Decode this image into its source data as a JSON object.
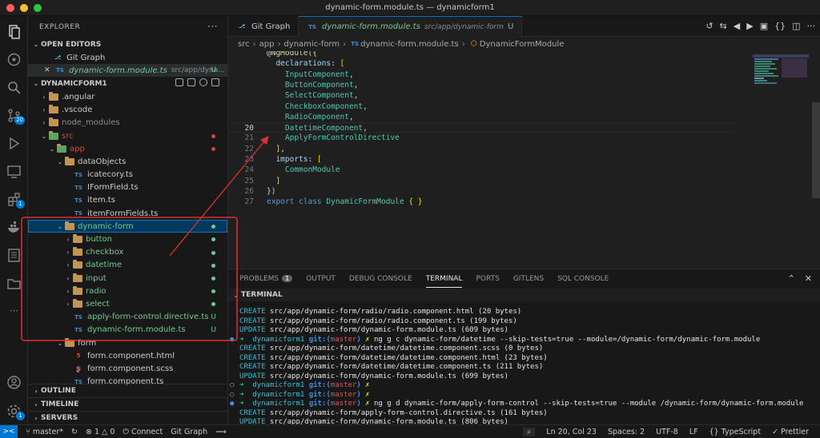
{
  "window": {
    "title": "dynamic-form.module.ts — dynamicform1"
  },
  "activity_bar": {
    "items": [
      {
        "name": "explorer-icon"
      },
      {
        "name": "git-graph-icon"
      },
      {
        "name": "search-icon"
      },
      {
        "name": "source-control-icon",
        "badge": "20"
      },
      {
        "name": "run-debug-icon"
      },
      {
        "name": "remote-explorer-icon"
      },
      {
        "name": "extensions-icon",
        "badge": "1"
      },
      {
        "name": "docker-icon"
      },
      {
        "name": "notebook-icon"
      },
      {
        "name": "folder-icon"
      },
      {
        "name": "more-icon",
        "glyph": "···"
      }
    ],
    "bottom": [
      {
        "name": "account-icon"
      },
      {
        "name": "manage-gear-icon",
        "badge": "1"
      }
    ]
  },
  "sidebar": {
    "title": "EXPLORER",
    "open_editors": {
      "label": "OPEN EDITORS",
      "items": [
        {
          "icon": "git-graph-icon",
          "label": "Git Graph",
          "desc": "",
          "deco": ""
        },
        {
          "icon": "TS",
          "label": "dynamic-form.module.ts",
          "desc": "src/app/dyna...",
          "deco": "U",
          "close": "✕"
        }
      ]
    },
    "project": {
      "label": "DYNAMICFORM1",
      "tree": [
        {
          "depth": 1,
          "chev": "›",
          "type": "folder",
          "label": ".angular",
          "color": "#cccccc"
        },
        {
          "depth": 1,
          "chev": "›",
          "type": "folder",
          "label": ".vscode",
          "color": "#cccccc"
        },
        {
          "depth": 1,
          "chev": "›",
          "type": "folder",
          "label": "node_modules",
          "color": "#8c8c8c"
        },
        {
          "depth": 1,
          "chev": "⌄",
          "type": "folder",
          "label": "src",
          "color": "#c74e39",
          "dot": "#c74e39"
        },
        {
          "depth": 2,
          "chev": "⌄",
          "type": "folder",
          "label": "app",
          "color": "#c74e39",
          "dot": "#c74e39"
        },
        {
          "depth": 3,
          "chev": "⌄",
          "type": "folder",
          "label": "dataObjects",
          "color": "#cccccc"
        },
        {
          "depth": 4,
          "chev": "",
          "type": "TS",
          "label": "icatecory.ts",
          "color": "#cccccc"
        },
        {
          "depth": 4,
          "chev": "",
          "type": "TS",
          "label": "IFormField.ts",
          "color": "#cccccc"
        },
        {
          "depth": 4,
          "chev": "",
          "type": "TS",
          "label": "item.ts",
          "color": "#cccccc"
        },
        {
          "depth": 4,
          "chev": "",
          "type": "TS",
          "label": "itemFormFields.ts",
          "color": "#cccccc"
        },
        {
          "depth": 3,
          "chev": "⌄",
          "type": "folder",
          "label": "dynamic-form",
          "color": "#73c991",
          "dot": "#73c991",
          "selected": true
        },
        {
          "depth": 4,
          "chev": "›",
          "type": "folder",
          "label": "button",
          "color": "#73c991",
          "dot": "#73c991"
        },
        {
          "depth": 4,
          "chev": "›",
          "type": "folder",
          "label": "checkbox",
          "color": "#73c991",
          "dot": "#73c991"
        },
        {
          "depth": 4,
          "chev": "›",
          "type": "folder",
          "label": "datetime",
          "color": "#73c991",
          "dot": "#73c991"
        },
        {
          "depth": 4,
          "chev": "›",
          "type": "folder",
          "label": "input",
          "color": "#73c991",
          "dot": "#73c991"
        },
        {
          "depth": 4,
          "chev": "›",
          "type": "folder",
          "label": "radio",
          "color": "#73c991",
          "dot": "#73c991"
        },
        {
          "depth": 4,
          "chev": "›",
          "type": "folder",
          "label": "select",
          "color": "#73c991",
          "dot": "#73c991"
        },
        {
          "depth": 4,
          "chev": "",
          "type": "TS",
          "label": "apply-form-control.directive.ts",
          "color": "#73c991",
          "deco": "U"
        },
        {
          "depth": 4,
          "chev": "",
          "type": "TS",
          "label": "dynamic-form.module.ts",
          "color": "#73c991",
          "deco": "U"
        },
        {
          "depth": 3,
          "chev": "⌄",
          "type": "folder",
          "label": "form",
          "color": "#cccccc"
        },
        {
          "depth": 4,
          "chev": "",
          "type": "html",
          "label": "form.component.html",
          "color": "#cccccc"
        },
        {
          "depth": 4,
          "chev": "",
          "type": "scss",
          "label": "form.component.scss",
          "color": "#cccccc"
        },
        {
          "depth": 4,
          "chev": "",
          "type": "TS",
          "label": "form.component.ts",
          "color": "#cccccc"
        }
      ]
    },
    "bottom_sections": [
      "OUTLINE",
      "TIMELINE",
      "SERVERS"
    ]
  },
  "tabs": [
    {
      "label": "Git Graph",
      "desc": "",
      "deco": ""
    },
    {
      "label": "dynamic-form.module.ts",
      "desc": "src/app/dynamic-form",
      "deco": "U",
      "active": true
    }
  ],
  "breadcrumb": [
    "src",
    "app",
    "dynamic-form",
    "dynamic-form.module.ts",
    "DynamicFormModule"
  ],
  "code_lines": [
    {
      "n": "",
      "t": [
        [
          "@NgModule({",
          "dec"
        ]
      ]
    },
    {
      "n": "",
      "t": [
        [
          "  declarations",
          "pr"
        ],
        [
          ": ",
          "pu"
        ],
        [
          "[",
          "br"
        ]
      ]
    },
    {
      "n": "",
      "t": [
        [
          "    InputComponent",
          "ty"
        ],
        [
          ",",
          "pu"
        ]
      ]
    },
    {
      "n": "",
      "t": [
        [
          "    ButtonComponent",
          "ty"
        ],
        [
          ",",
          "pu"
        ]
      ]
    },
    {
      "n": "",
      "t": [
        [
          "    SelectComponent",
          "ty"
        ],
        [
          ",",
          "pu"
        ]
      ]
    },
    {
      "n": "",
      "t": [
        [
          "    CheckboxComponent",
          "ty"
        ],
        [
          ",",
          "pu"
        ]
      ]
    },
    {
      "n": "",
      "t": [
        [
          "    RadioComponent",
          "ty"
        ],
        [
          ",",
          "pu"
        ]
      ]
    },
    {
      "n": "20",
      "t": [
        [
          "    DatetimeComponent",
          "ty"
        ],
        [
          ",",
          "pu"
        ]
      ],
      "current": true
    },
    {
      "n": "21",
      "t": [
        [
          "    ApplyFormControlDirective",
          "ty"
        ]
      ]
    },
    {
      "n": "22",
      "t": [
        [
          "  ",
          "pu"
        ],
        [
          "]",
          "br"
        ],
        [
          ",",
          "pu"
        ]
      ]
    },
    {
      "n": "23",
      "t": [
        [
          "  imports",
          "pr"
        ],
        [
          ": ",
          "pu"
        ],
        [
          "[",
          "br"
        ]
      ]
    },
    {
      "n": "24",
      "t": [
        [
          "    CommonModule",
          "ty"
        ]
      ]
    },
    {
      "n": "25",
      "t": [
        [
          "  ",
          "pu"
        ],
        [
          "]",
          "br"
        ]
      ]
    },
    {
      "n": "26",
      "t": [
        [
          "})",
          "pu"
        ]
      ]
    },
    {
      "n": "27",
      "t": [
        [
          "export ",
          "kw"
        ],
        [
          "class ",
          "kw"
        ],
        [
          "DynamicFormModule ",
          "ty"
        ],
        [
          "{ }",
          "br"
        ]
      ]
    }
  ],
  "panel": {
    "tabs": [
      {
        "label": "PROBLEMS",
        "badge": "1"
      },
      {
        "label": "OUTPUT"
      },
      {
        "label": "DEBUG CONSOLE"
      },
      {
        "label": "TERMINAL",
        "active": true
      },
      {
        "label": "PORTS"
      },
      {
        "label": "GITLENS"
      },
      {
        "label": "SQL CONSOLE"
      }
    ],
    "terminal_header": "TERMINAL",
    "lines": [
      {
        "m": "",
        "s": [
          [
            "CREATE",
            "cy"
          ],
          [
            " src/app/dynamic-form/radio/radio.component.html (20 bytes)",
            "wh"
          ]
        ]
      },
      {
        "m": "",
        "s": [
          [
            "CREATE",
            "cy"
          ],
          [
            " src/app/dynamic-form/radio/radio.component.ts (199 bytes)",
            "wh"
          ]
        ]
      },
      {
        "m": "",
        "s": [
          [
            "UPDATE",
            "cy"
          ],
          [
            " src/app/dynamic-form/dynamic-form.module.ts (609 bytes)",
            "wh"
          ]
        ]
      },
      {
        "m": "●",
        "mc": "#3b8eea",
        "s": [
          [
            "➜  ",
            "arr"
          ],
          [
            "dynamicform1 ",
            "cy"
          ],
          [
            "git:(",
            "gl"
          ],
          [
            "master",
            "rd"
          ],
          [
            ") ",
            "gl"
          ],
          [
            "✗ ",
            "yl"
          ],
          [
            "ng g c dynamic-form/datetime --skip-tests=true --module=/dynamic-form/dynamic-form.module",
            "wh"
          ]
        ]
      },
      {
        "m": "",
        "s": [
          [
            "CREATE",
            "cy"
          ],
          [
            " src/app/dynamic-form/datetime/datetime.component.scss (0 bytes)",
            "wh"
          ]
        ]
      },
      {
        "m": "",
        "s": [
          [
            "CREATE",
            "cy"
          ],
          [
            " src/app/dynamic-form/datetime/datetime.component.html (23 bytes)",
            "wh"
          ]
        ]
      },
      {
        "m": "",
        "s": [
          [
            "CREATE",
            "cy"
          ],
          [
            " src/app/dynamic-form/datetime/datetime.component.ts (211 bytes)",
            "wh"
          ]
        ]
      },
      {
        "m": "",
        "s": [
          [
            "UPDATE",
            "cy"
          ],
          [
            " src/app/dynamic-form/dynamic-form.module.ts (699 bytes)",
            "wh"
          ]
        ]
      },
      {
        "m": "○",
        "mc": "#999",
        "s": [
          [
            "➜  ",
            "arr"
          ],
          [
            "dynamicform1 ",
            "cy"
          ],
          [
            "git:(",
            "gl"
          ],
          [
            "master",
            "rd"
          ],
          [
            ") ",
            "gl"
          ],
          [
            "✗",
            "yl"
          ]
        ]
      },
      {
        "m": "○",
        "mc": "#999",
        "s": [
          [
            "➜  ",
            "arr"
          ],
          [
            "dynamicform1 ",
            "cy"
          ],
          [
            "git:(",
            "gl"
          ],
          [
            "master",
            "rd"
          ],
          [
            ") ",
            "gl"
          ],
          [
            "✗",
            "yl"
          ]
        ]
      },
      {
        "m": "●",
        "mc": "#3b8eea",
        "s": [
          [
            "➜  ",
            "arr"
          ],
          [
            "dynamicform1 ",
            "cy"
          ],
          [
            "git:(",
            "gl"
          ],
          [
            "master",
            "rd"
          ],
          [
            ") ",
            "gl"
          ],
          [
            "✗ ",
            "yl"
          ],
          [
            "ng g d dynamic-form/apply-form-control --skip-tests=true --module /dynamic-form/dynamic-form.module",
            "wh"
          ]
        ]
      },
      {
        "m": "",
        "s": [
          [
            "CREATE",
            "cy"
          ],
          [
            " src/app/dynamic-form/apply-form-control.directive.ts (161 bytes)",
            "wh"
          ]
        ]
      },
      {
        "m": "",
        "s": [
          [
            "UPDATE",
            "cy"
          ],
          [
            " src/app/dynamic-form/dynamic-form.module.ts (806 bytes)",
            "wh"
          ]
        ]
      },
      {
        "m": "○",
        "mc": "#999",
        "s": [
          [
            "➜  ",
            "arr"
          ],
          [
            "dynamicform1 ",
            "cy"
          ],
          [
            "git:(",
            "gl"
          ],
          [
            "master",
            "rd"
          ],
          [
            ") ",
            "gl"
          ],
          [
            "✗ ",
            "yl"
          ],
          [
            "▯",
            "wh"
          ]
        ]
      }
    ]
  },
  "statusbar": {
    "remote": "><",
    "branch": "master*",
    "sync": "↻",
    "problems": "⊗ 1 △ 0",
    "connect": "Connect",
    "gitgraph": "Git Graph",
    "right": [
      "Ln 20, Col 23",
      "Spaces: 2",
      "UTF-8",
      "LF",
      "{} TypeScript",
      "✓ Prettier"
    ]
  },
  "colors": {
    "accent": "#0078d4",
    "annotation": "#e03030"
  }
}
